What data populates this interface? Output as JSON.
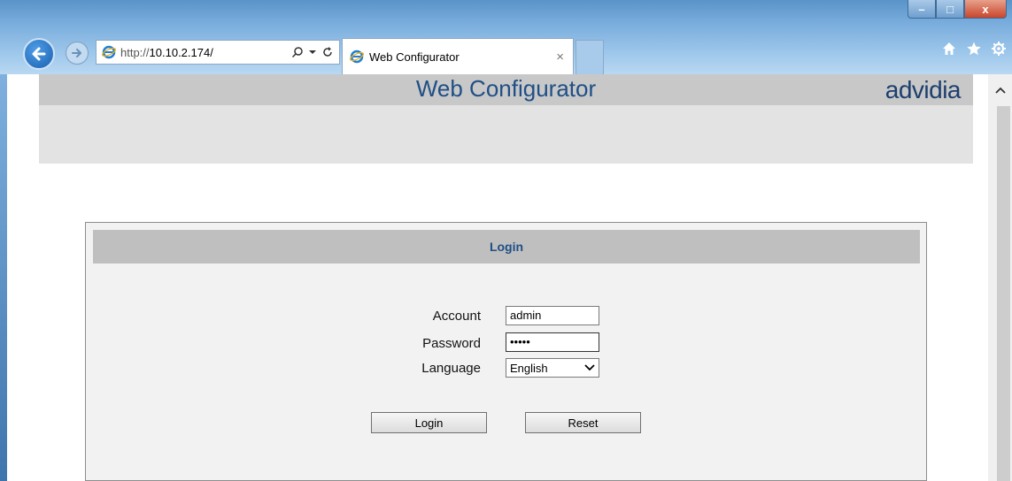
{
  "browser": {
    "address_url_prefix": "http://",
    "address_url_host": "10.10.2.174/",
    "tab_title": "Web Configurator",
    "tab_close": "×",
    "window_controls": {
      "minimize": "–",
      "maximize": "□",
      "close": "x"
    },
    "toolbar_icons": [
      "home-icon",
      "star-icon",
      "gear-icon"
    ]
  },
  "page": {
    "title": "Web Configurator",
    "brand": "advidia"
  },
  "login": {
    "header": "Login",
    "account_label": "Account",
    "password_label": "Password",
    "language_label": "Language",
    "account_value": "admin",
    "password_mask": "•••••",
    "language_value": "English",
    "login_button": "Login",
    "reset_button": "Reset"
  },
  "colors": {
    "title_blue": "#1f4f86",
    "header_gray": "#c8c8c8",
    "panel_bg": "#f2f2f2"
  }
}
